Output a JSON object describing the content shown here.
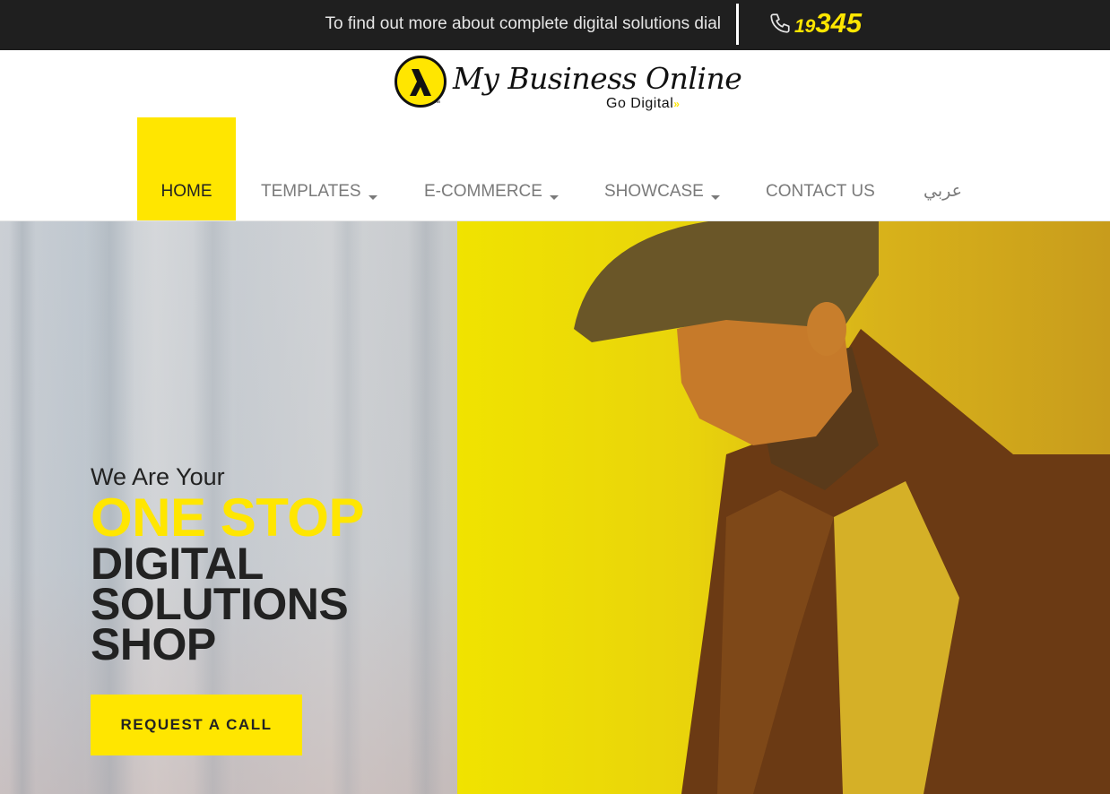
{
  "topbar": {
    "text": "To find out more about complete digital solutions dial",
    "phone_prefix": "19",
    "phone_main": "345",
    "phone_icon": "phone-icon"
  },
  "logo": {
    "title": "My Business Online",
    "tagline": "Go Digital",
    "tagline_suffix": "»",
    "tm": "™"
  },
  "nav": {
    "items": [
      {
        "label": "HOME",
        "active": true,
        "dropdown": false
      },
      {
        "label": "TEMPLATES",
        "active": false,
        "dropdown": true
      },
      {
        "label": "E-COMMERCE",
        "active": false,
        "dropdown": true
      },
      {
        "label": "SHOWCASE",
        "active": false,
        "dropdown": true
      },
      {
        "label": "CONTACT US",
        "active": false,
        "dropdown": false
      },
      {
        "label": "عربي",
        "active": false,
        "dropdown": false
      }
    ]
  },
  "hero": {
    "subheading": "We Are Your",
    "highlight": "ONE STOP",
    "lines": [
      "DIGITAL",
      "SOLUTIONS",
      "SHOP"
    ],
    "cta_label": "REQUEST A CALL"
  },
  "colors": {
    "brand_yellow": "#ffe600",
    "topbar_bg": "#1f1f1f",
    "text_dark": "#222222",
    "nav_text": "#7a7a7a"
  }
}
